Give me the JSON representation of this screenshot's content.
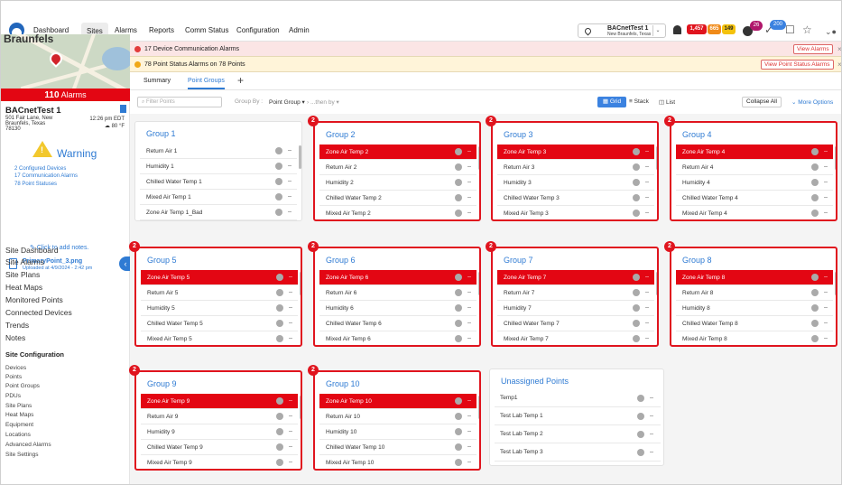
{
  "nav": {
    "items": [
      "Dashboard",
      "Sites",
      "Alarms",
      "Reports",
      "Comm Status",
      "Configuration",
      "Admin"
    ],
    "active": "Sites"
  },
  "site_select": {
    "name": "BACnetTest 1",
    "location": "New Braunfels, Texas"
  },
  "badges": {
    "alarm_count": "1,457",
    "comm_count": "665",
    "status_count": "149",
    "circle_a": "26",
    "circle_b": "200"
  },
  "site": {
    "map_label": "Braunfels",
    "alarms_count": "110",
    "alarms_label": "Alarms",
    "name": "BACnetTest 1",
    "address": "501 Fair Lane, New Braunfels, Texas 78130",
    "time": "12:26 pm EDT",
    "temp": "80 °F",
    "status": "Warning",
    "status_links": [
      "2 Configured Devices",
      "17 Communication Alarms",
      "78 Point Statuses"
    ],
    "notes_link": "Click to add notes.",
    "file_name": "PrimaryPoint_3.png",
    "file_uploaded": "Uploaded at 4/9/2024 - 2:42 pm"
  },
  "side_menu": [
    "Site Dashboard",
    "Site Alarms",
    "Site Plans",
    "Heat Maps",
    "Monitored Points",
    "Connected Devices",
    "Trends",
    "Notes"
  ],
  "site_config": {
    "title": "Site Configuration",
    "items": [
      "Devices",
      "Points",
      "Point Groups",
      "PDUs",
      "Site Plans",
      "Heat Maps",
      "Equipment",
      "Locations",
      "Advanced Alarms",
      "Site Settings"
    ]
  },
  "banners": [
    {
      "text": "17 Device Communication Alarms",
      "button": "View Alarms",
      "color": "#e23b3b",
      "bg": "#fbe5e5"
    },
    {
      "text": "78 Point Status Alarms on 78 Points",
      "button": "View Point Status Alarms",
      "color": "#f0a818",
      "bg": "#fff4d9"
    }
  ],
  "tabs": {
    "summary": "Summary",
    "point_groups": "Point Groups"
  },
  "toolbar": {
    "filter_placeholder": "Filter Points",
    "group_by": "Group By :",
    "group_value": "Point Group ▾",
    "then_by": "› ...then by ▾",
    "grid": "Grid",
    "stack": "Stack",
    "list": "List",
    "collapse_all": "Collapse All",
    "more_options": "More Options"
  },
  "value_placeholder": "--",
  "groups": [
    {
      "title": "Group 1",
      "alarm": false,
      "badge": "",
      "rows": [
        {
          "name": "Return Air 1",
          "hl": false
        },
        {
          "name": "Humidity 1",
          "hl": false
        },
        {
          "name": "Chilled Water Temp 1",
          "hl": false
        },
        {
          "name": "Mixed Air Temp 1",
          "hl": false
        },
        {
          "name": "Zone Air Temp 1_Bad",
          "hl": false
        }
      ]
    },
    {
      "title": "Group 2",
      "alarm": true,
      "badge": "2",
      "rows": [
        {
          "name": "Zone Air Temp 2",
          "hl": true
        },
        {
          "name": "Return Air 2",
          "hl": false
        },
        {
          "name": "Humidity 2",
          "hl": false
        },
        {
          "name": "Chilled Water Temp 2",
          "hl": false
        },
        {
          "name": "Mixed Air Temp 2",
          "hl": false
        }
      ]
    },
    {
      "title": "Group 3",
      "alarm": true,
      "badge": "2",
      "rows": [
        {
          "name": "Zone Air Temp 3",
          "hl": true
        },
        {
          "name": "Return Air 3",
          "hl": false
        },
        {
          "name": "Humidity 3",
          "hl": false
        },
        {
          "name": "Chilled Water Temp 3",
          "hl": false
        },
        {
          "name": "Mixed Air Temp 3",
          "hl": false
        }
      ]
    },
    {
      "title": "Group 4",
      "alarm": true,
      "badge": "2",
      "rows": [
        {
          "name": "Zone Air Temp 4",
          "hl": true
        },
        {
          "name": "Return Air 4",
          "hl": false
        },
        {
          "name": "Humidity 4",
          "hl": false
        },
        {
          "name": "Chilled Water Temp 4",
          "hl": false
        },
        {
          "name": "Mixed Air Temp 4",
          "hl": false
        }
      ]
    },
    {
      "title": "Group 5",
      "alarm": true,
      "badge": "2",
      "rows": [
        {
          "name": "Zone Air Temp 5",
          "hl": true
        },
        {
          "name": "Return Air 5",
          "hl": false
        },
        {
          "name": "Humidity 5",
          "hl": false
        },
        {
          "name": "Chilled Water Temp 5",
          "hl": false
        },
        {
          "name": "Mixed Air Temp 5",
          "hl": false
        }
      ]
    },
    {
      "title": "Group 6",
      "alarm": true,
      "badge": "2",
      "rows": [
        {
          "name": "Zone Air Temp 6",
          "hl": true
        },
        {
          "name": "Return Air 6",
          "hl": false
        },
        {
          "name": "Humidity 6",
          "hl": false
        },
        {
          "name": "Chilled Water Temp 6",
          "hl": false
        },
        {
          "name": "Mixed Air Temp 6",
          "hl": false
        }
      ]
    },
    {
      "title": "Group 7",
      "alarm": true,
      "badge": "2",
      "rows": [
        {
          "name": "Zone Air Temp 7",
          "hl": true
        },
        {
          "name": "Return Air 7",
          "hl": false
        },
        {
          "name": "Humidity 7",
          "hl": false
        },
        {
          "name": "Chilled Water Temp 7",
          "hl": false
        },
        {
          "name": "Mixed Air Temp 7",
          "hl": false
        }
      ]
    },
    {
      "title": "Group 8",
      "alarm": true,
      "badge": "2",
      "rows": [
        {
          "name": "Zone Air Temp 8",
          "hl": true
        },
        {
          "name": "Return Air 8",
          "hl": false
        },
        {
          "name": "Humidity 8",
          "hl": false
        },
        {
          "name": "Chilled Water Temp 8",
          "hl": false
        },
        {
          "name": "Mixed Air Temp 8",
          "hl": false
        }
      ]
    },
    {
      "title": "Group 9",
      "alarm": true,
      "badge": "2",
      "rows": [
        {
          "name": "Zone Air Temp 9",
          "hl": true
        },
        {
          "name": "Return Air 9",
          "hl": false
        },
        {
          "name": "Humidity 9",
          "hl": false
        },
        {
          "name": "Chilled Water Temp 9",
          "hl": false
        },
        {
          "name": "Mixed Air Temp 9",
          "hl": false
        }
      ]
    },
    {
      "title": "Group 10",
      "alarm": true,
      "badge": "2",
      "rows": [
        {
          "name": "Zone Air Temp 10",
          "hl": true
        },
        {
          "name": "Return Air 10",
          "hl": false
        },
        {
          "name": "Humidity 10",
          "hl": false
        },
        {
          "name": "Chilled Water Temp 10",
          "hl": false
        },
        {
          "name": "Mixed Air Temp 10",
          "hl": false
        }
      ]
    }
  ],
  "unassigned": {
    "title": "Unassigned Points",
    "rows": [
      "Temp1",
      "Test Lab Temp 1",
      "Test Lab Temp 2",
      "Test Lab Temp 3"
    ]
  }
}
